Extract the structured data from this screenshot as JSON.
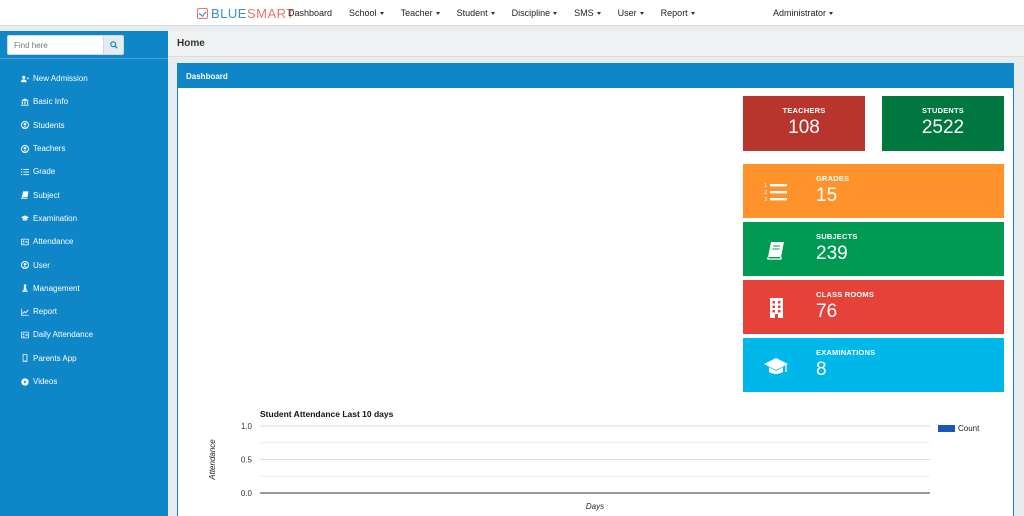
{
  "brand": {
    "part1": "BLUE",
    "part2": "SMART"
  },
  "nav": [
    {
      "label": "Dashboard",
      "dropdown": false
    },
    {
      "label": "School",
      "dropdown": true
    },
    {
      "label": "Teacher",
      "dropdown": true
    },
    {
      "label": "Student",
      "dropdown": true
    },
    {
      "label": "Discipline",
      "dropdown": true
    },
    {
      "label": "SMS",
      "dropdown": true
    },
    {
      "label": "User",
      "dropdown": true
    },
    {
      "label": "Report",
      "dropdown": true
    }
  ],
  "account": {
    "label": "Administrator"
  },
  "sidebar": {
    "search_placeholder": "Find here",
    "items": [
      {
        "label": "New Admission",
        "icon": "user-plus-icon"
      },
      {
        "label": "Basic Info",
        "icon": "institution-icon"
      },
      {
        "label": "Students",
        "icon": "user-circle-icon"
      },
      {
        "label": "Teachers",
        "icon": "user-circle-icon"
      },
      {
        "label": "Grade",
        "icon": "list-icon"
      },
      {
        "label": "Subject",
        "icon": "book-icon"
      },
      {
        "label": "Examination",
        "icon": "graduation-cap-icon"
      },
      {
        "label": "Attendance",
        "icon": "id-card-icon"
      },
      {
        "label": "User",
        "icon": "user-circle-icon"
      },
      {
        "label": "Management",
        "icon": "pawn-icon"
      },
      {
        "label": "Report",
        "icon": "line-chart-icon"
      },
      {
        "label": "Daily Attendance",
        "icon": "id-card-icon"
      },
      {
        "label": "Parents App",
        "icon": "mobile-icon"
      },
      {
        "label": "Videos",
        "icon": "play-circle-icon"
      }
    ]
  },
  "page": {
    "title": "Home",
    "panel_title": "Dashboard"
  },
  "stats": {
    "teachers": {
      "label": "TEACHERS",
      "value": "108",
      "color": "#b8352d"
    },
    "students": {
      "label": "STUDENTS",
      "value": "2522",
      "color": "#00773f"
    },
    "grades": {
      "label": "GRADES",
      "value": "15",
      "color": "#ff922b",
      "icon": "list-ol-icon"
    },
    "subjects": {
      "label": "SUBJECTS",
      "value": "239",
      "color": "#009a52",
      "icon": "book-icon"
    },
    "classrooms": {
      "label": "CLASS ROOMS",
      "value": "76",
      "color": "#e5433a",
      "icon": "building-icon"
    },
    "examinations": {
      "label": "EXAMINATIONS",
      "value": "8",
      "color": "#00b7ea",
      "icon": "graduation-cap-icon"
    }
  },
  "chart_data": {
    "type": "line",
    "title": "Student Attendance Last 10 days",
    "xlabel": "Days",
    "ylabel": "Attendance",
    "ylim": [
      0,
      1
    ],
    "y_ticks": [
      "1.0",
      "0.5",
      "0.0"
    ],
    "grid": true,
    "legend_position": "right",
    "series": [
      {
        "name": "Count",
        "values": [],
        "color": "#1a56b8"
      }
    ]
  }
}
